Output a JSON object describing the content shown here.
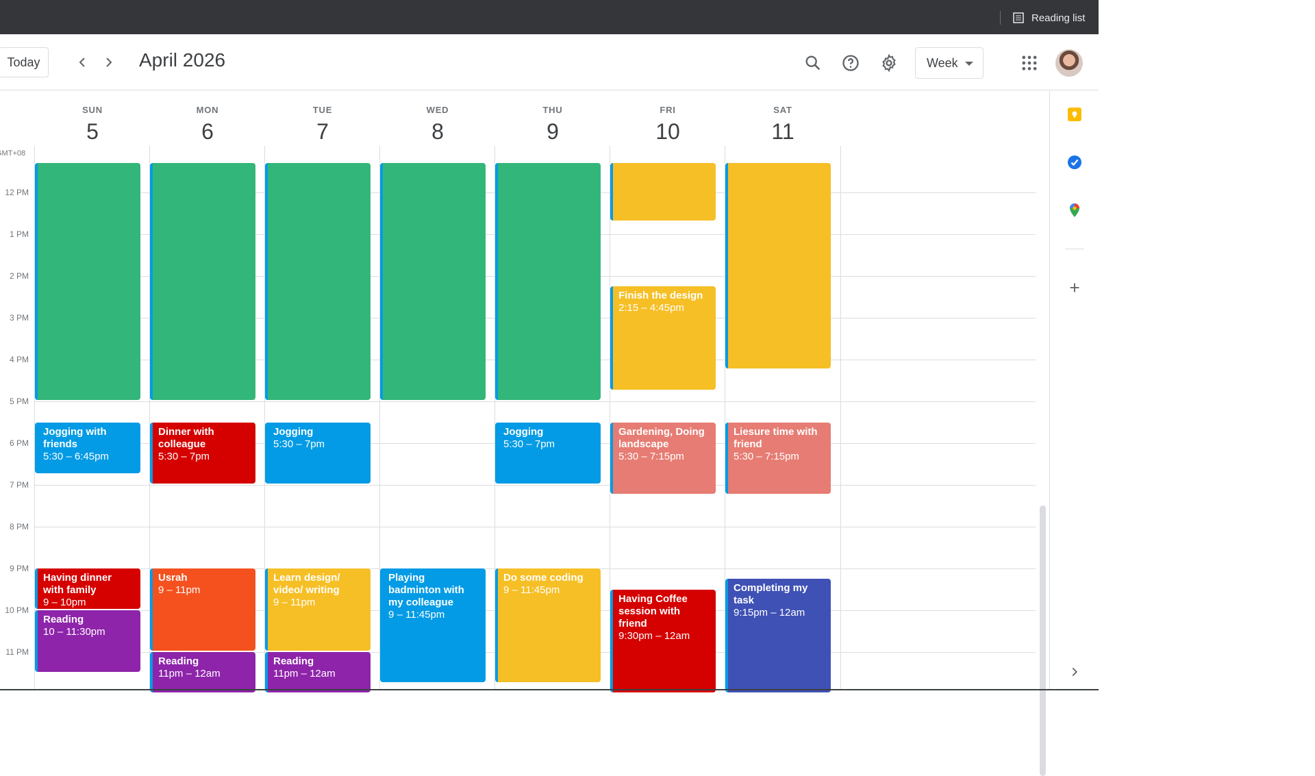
{
  "browser": {
    "reading_list": "Reading list"
  },
  "header": {
    "today": "Today",
    "title": "April 2026",
    "view": "Week"
  },
  "timezone": "GMT+08",
  "days": [
    {
      "dow": "SUN",
      "num": "5"
    },
    {
      "dow": "MON",
      "num": "6"
    },
    {
      "dow": "TUE",
      "num": "7"
    },
    {
      "dow": "WED",
      "num": "8"
    },
    {
      "dow": "THU",
      "num": "9"
    },
    {
      "dow": "FRI",
      "num": "10"
    },
    {
      "dow": "SAT",
      "num": "11"
    }
  ],
  "hours": [
    "12 PM",
    "1 PM",
    "2 PM",
    "3 PM",
    "4 PM",
    "5 PM",
    "6 PM",
    "7 PM",
    "8 PM",
    "9 PM",
    "10 PM",
    "11 PM"
  ],
  "colors": {
    "green": "#33b679",
    "blue": "#039be5",
    "red": "#d50000",
    "orange": "#f4511e",
    "yellow": "#f6bf26",
    "purple": "#8e24aa",
    "flamingo": "#e67c73",
    "indigo": "#3f51b5"
  },
  "events": [
    {
      "day": 0,
      "start": 11.3,
      "end": 17,
      "color": "green",
      "title": "",
      "time": ""
    },
    {
      "day": 1,
      "start": 11.3,
      "end": 17,
      "color": "green",
      "title": "",
      "time": ""
    },
    {
      "day": 2,
      "start": 11.3,
      "end": 17,
      "color": "green",
      "title": "",
      "time": ""
    },
    {
      "day": 3,
      "start": 11.3,
      "end": 17,
      "color": "green",
      "title": "",
      "time": ""
    },
    {
      "day": 4,
      "start": 11.3,
      "end": 17,
      "color": "green",
      "title": "",
      "time": ""
    },
    {
      "day": 5,
      "start": 11.3,
      "end": 12.7,
      "color": "yellow",
      "title": "",
      "time": ""
    },
    {
      "day": 6,
      "start": 11.3,
      "end": 16.25,
      "color": "yellow",
      "title": "",
      "time": ""
    },
    {
      "day": 5,
      "start": 14.25,
      "end": 16.75,
      "color": "yellow",
      "title": "Finish the design",
      "time": "2:15 – 4:45pm"
    },
    {
      "day": 0,
      "start": 17.5,
      "end": 18.75,
      "color": "blue",
      "title": "Jogging with friends",
      "time": "5:30 – 6:45pm"
    },
    {
      "day": 1,
      "start": 17.5,
      "end": 19,
      "color": "red",
      "title": "Dinner with colleague",
      "time": "5:30 – 7pm"
    },
    {
      "day": 2,
      "start": 17.5,
      "end": 19,
      "color": "blue",
      "title": "Jogging",
      "time": "5:30 – 7pm"
    },
    {
      "day": 4,
      "start": 17.5,
      "end": 19,
      "color": "blue",
      "title": "Jogging",
      "time": "5:30 – 7pm"
    },
    {
      "day": 5,
      "start": 17.5,
      "end": 19.25,
      "color": "flamingo",
      "title": "Gardening, Doing landscape",
      "time": "5:30 – 7:15pm"
    },
    {
      "day": 6,
      "start": 17.5,
      "end": 19.25,
      "color": "flamingo",
      "title": "Liesure time with friend",
      "time": "5:30 – 7:15pm"
    },
    {
      "day": 0,
      "start": 21,
      "end": 22,
      "color": "red",
      "title": "Having dinner with family",
      "time": "9 – 10pm"
    },
    {
      "day": 0,
      "start": 22,
      "end": 23.5,
      "color": "purple",
      "title": "Reading",
      "time": "10 – 11:30pm"
    },
    {
      "day": 1,
      "start": 21,
      "end": 23,
      "color": "orange",
      "title": "Usrah",
      "time": "9 – 11pm"
    },
    {
      "day": 1,
      "start": 23,
      "end": 24,
      "color": "purple",
      "title": "Reading",
      "time": "11pm – 12am"
    },
    {
      "day": 2,
      "start": 21,
      "end": 23,
      "color": "yellow",
      "title": "Learn design/ video/ writing",
      "time": "9 – 11pm"
    },
    {
      "day": 2,
      "start": 23,
      "end": 24,
      "color": "purple",
      "title": "Reading",
      "time": "11pm – 12am"
    },
    {
      "day": 3,
      "start": 21,
      "end": 23.75,
      "color": "blue",
      "title": "Playing badminton with my colleague",
      "time": "9 – 11:45pm"
    },
    {
      "day": 4,
      "start": 21,
      "end": 23.75,
      "color": "yellow",
      "title": "Do some coding",
      "time": "9 – 11:45pm"
    },
    {
      "day": 5,
      "start": 21.5,
      "end": 24,
      "color": "red",
      "title": "Having Coffee session with friend",
      "time": "9:30pm – 12am"
    },
    {
      "day": 6,
      "start": 21.25,
      "end": 24,
      "color": "indigo",
      "title": "Completing my task",
      "time": "9:15pm – 12am"
    }
  ],
  "icons": {
    "search": "search-icon",
    "help": "help-icon",
    "settings": "gear-icon",
    "apps": "apps-grid-icon",
    "keep": "keep-icon",
    "tasks": "tasks-icon",
    "maps": "maps-icon",
    "add": "plus-icon",
    "expand": "chevron-right-icon"
  }
}
